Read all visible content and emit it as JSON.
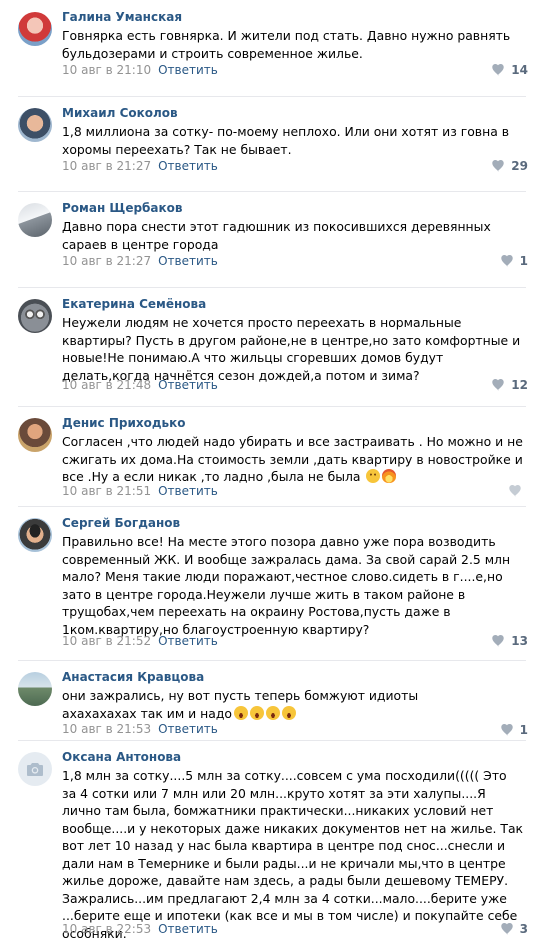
{
  "comments": [
    {
      "author": "Галина Уманская",
      "text": "Говнярка есть говнярка. И жители под стать. Давно нужно равнять бульдозерами и строить современное жилье.",
      "date": "10 авг в 21:10",
      "reply": "Ответить",
      "likes": "14"
    },
    {
      "author": "Михаил Соколов",
      "text": "1,8 миллиона за сотку- по-моему неплохо. Или они хотят из говна в хоромы переехать? Так не бывает.",
      "date": "10 авг в 21:27",
      "reply": "Ответить",
      "likes": "29"
    },
    {
      "author": "Роман Щербаков",
      "text": "Давно пора снести этот гадюшник из покосившихся деревянных сараев в центре города",
      "date": "10 авг в 21:27",
      "reply": "Ответить",
      "likes": "1"
    },
    {
      "author": "Екатерина Семёнова",
      "text": "Неужели людям не хочется просто переехать в нормальные квартиры? Пусть в другом районе,не в центре,но зато комфортные и новые!Не понимаю.А что жильцы сгоревших домов будут делать,когда начнётся сезон дождей,а потом и зима?",
      "date": "10 авг в 21:48",
      "reply": "Ответить",
      "likes": "12"
    },
    {
      "author": "Денис Приходько",
      "text": "Согласен ,что людей надо убирать и все застраивать . Но можно и не сжигать их дома.На стоимость земли ,дать квартиру в новостройке и все .Ну а если никак ,то ладно ,была не была",
      "date": "10 авг в 21:51",
      "reply": "Ответить",
      "likes": ""
    },
    {
      "author": "Сергей Богданов",
      "text": "Правильно все! На месте этого позора давно уже пора возводить современный ЖК. И вообще зажралась дама. За свой сарай 2.5 млн мало? Меня такие люди поражают,честное слово.сидеть в г....е,но зато в центре города.Неужели лучше жить в таком районе в трущобах,чем переехать на окраину Ростова,пусть даже в 1ком.квартиру,но благоустроенную квартиру?",
      "date": "10 авг в 21:52",
      "reply": "Ответить",
      "likes": "13"
    },
    {
      "author": "Анастасия Кравцова",
      "text": "они зажрались, ну вот пусть теперь бомжуют идиоты ахахахахах так им и надо",
      "date": "10 авг в 21:53",
      "reply": "Ответить",
      "likes": "1"
    },
    {
      "author": "Оксана Антонова",
      "text": "1,8 млн за сотку....5 млн за сотку....совсем с ума посходили((((( Это за 4 сотки или 7 млн или 20 млн...круто хотят за эти халупы....Я лично там была, бомжатники практически...никаких условий нет вообще....и у некоторых даже никаких документов нет на жилье. Так вот лет 10 назад у нас была квартира в центре под снос...снесли и дали нам в Темернике и были рады...и не кричали мы,что в центре жилье дороже, давайте нам здесь, а рады были дешевому ТЕМЕРУ. Зажрались...им предлагают 2,4 млн за 4 сотки...мало....берите уже ...берите еще и ипотеки (как все и мы в том числе) и покупайте себе особняки.",
      "date": "10 авг в 22:53",
      "reply": "Ответить",
      "likes": "3"
    }
  ],
  "colors": {
    "author": "#2a5885",
    "meta": "#939393",
    "accent": "#5a6a7d",
    "separator": "#e7e8ec"
  },
  "icons": {
    "like": "heart-icon",
    "camera": "camera-icon",
    "emoji": "smiley-icon"
  }
}
